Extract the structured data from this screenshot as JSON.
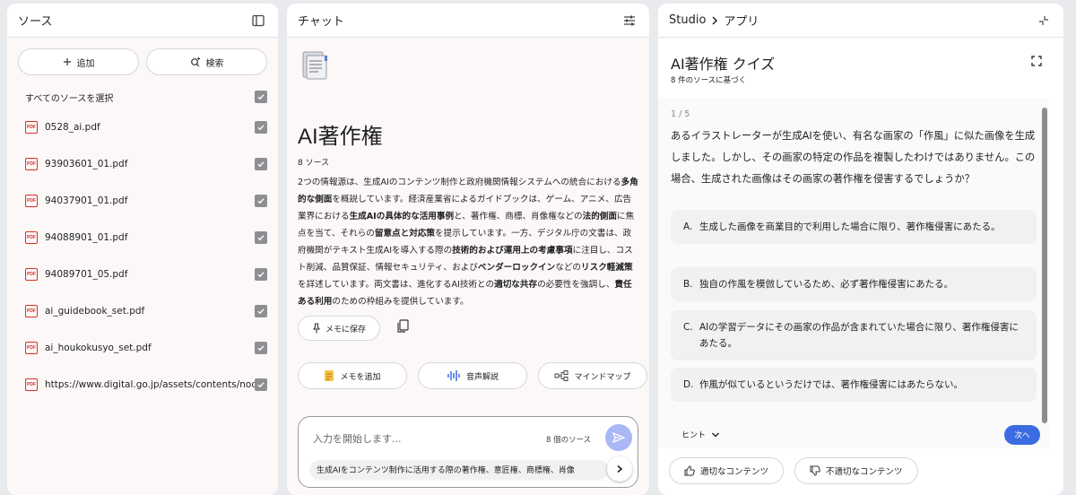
{
  "sources_panel": {
    "title": "ソース",
    "add_label": "追加",
    "search_label": "検索",
    "select_all_label": "すべてのソースを選択",
    "items": [
      {
        "name": "0528_ai.pdf",
        "icon": "pdf-icon"
      },
      {
        "name": "93903601_01.pdf",
        "icon": "pdf-icon"
      },
      {
        "name": "94037901_01.pdf",
        "icon": "pdf-icon"
      },
      {
        "name": "94088901_01.pdf",
        "icon": "pdf-icon"
      },
      {
        "name": "94089701_05.pdf",
        "icon": "pdf-icon"
      },
      {
        "name": "ai_guidebook_set.pdf",
        "icon": "pdf-icon"
      },
      {
        "name": "ai_houkokusyo_set.pdf",
        "icon": "pdf-icon"
      },
      {
        "name": "https://www.digital.go.jp/assets/contents/nod...",
        "icon": "pdf-icon"
      }
    ]
  },
  "chat_panel": {
    "title": "チャット",
    "notebook_title": "AI著作権",
    "source_count": "8 ソース",
    "summary_parts": [
      {
        "t": "2つの情報源は、生成AIのコンテンツ制作と政府機関情報システムへの統合における",
        "b": false
      },
      {
        "t": "多角的な側面",
        "b": true
      },
      {
        "t": "を概説しています。経済産業省によるガイドブックは、ゲーム、アニメ、広告業界における",
        "b": false
      },
      {
        "t": "生成AIの具体的な活用事例",
        "b": true
      },
      {
        "t": "と、著作権、商標、肖像権などの",
        "b": false
      },
      {
        "t": "法的側面",
        "b": true
      },
      {
        "t": "に焦点を当て、それらの",
        "b": false
      },
      {
        "t": "留意点と対応策",
        "b": true
      },
      {
        "t": "を提示しています。一方、デジタル庁の文書は、政府機関がテキスト生成AIを導入する際の",
        "b": false
      },
      {
        "t": "技術的および運用上の考慮事項",
        "b": true
      },
      {
        "t": "に注目し、コスト削減、品質保証、情報セキュリティ、および",
        "b": false
      },
      {
        "t": "ベンダーロックイン",
        "b": true
      },
      {
        "t": "などの",
        "b": false
      },
      {
        "t": "リスク軽減策",
        "b": true
      },
      {
        "t": "を詳述しています。両文書は、進化するAI技術との",
        "b": false
      },
      {
        "t": "適切な共存",
        "b": true
      },
      {
        "t": "の必要性を強調し、",
        "b": false
      },
      {
        "t": "責任ある利用",
        "b": true
      },
      {
        "t": "のための枠組みを提供しています。",
        "b": false
      }
    ],
    "save_memo_label": "メモに保存",
    "actions": [
      {
        "label": "メモを追加",
        "icon": "note-add-icon"
      },
      {
        "label": "音声解説",
        "icon": "audio-wave-icon"
      },
      {
        "label": "マインドマップ",
        "icon": "mind-map-icon"
      }
    ],
    "input_placeholder": "入力を開始します...",
    "input_source_count": "8 個のソース",
    "suggestion": "生成AIをコンテンツ制作に活用する際の著作権、意匠権、商標権、肖像"
  },
  "studio_panel": {
    "crumb_studio": "Studio",
    "crumb_app": "アプリ",
    "quiz_title": "AI著作権 クイズ",
    "quiz_subtitle": "8 件のソースに基づく",
    "question_number": "1 / 5",
    "question": "あるイラストレーターが生成AIを使い、有名な画家の「作風」に似た画像を生成しました。しかし、その画家の特定の作品を複製したわけではありません。この場合、生成された画像はその画家の著作権を侵害するでしょうか？",
    "options": [
      {
        "letter": "A.",
        "text": "生成した画像を商業目的で利用した場合に限り、著作権侵害にあたる。"
      },
      {
        "letter": "B.",
        "text": "独自の作風を模倣しているため、必ず著作権侵害にあたる。"
      },
      {
        "letter": "C.",
        "text": "AIの学習データにその画家の作品が含まれていた場合に限り、著作権侵害にあたる。"
      },
      {
        "letter": "D.",
        "text": "作風が似ているというだけでは、著作権侵害にはあたらない。"
      }
    ],
    "hint_label": "ヒント",
    "next_label": "次へ",
    "good_label": "適切なコンテンツ",
    "bad_label": "不適切なコンテンツ"
  }
}
